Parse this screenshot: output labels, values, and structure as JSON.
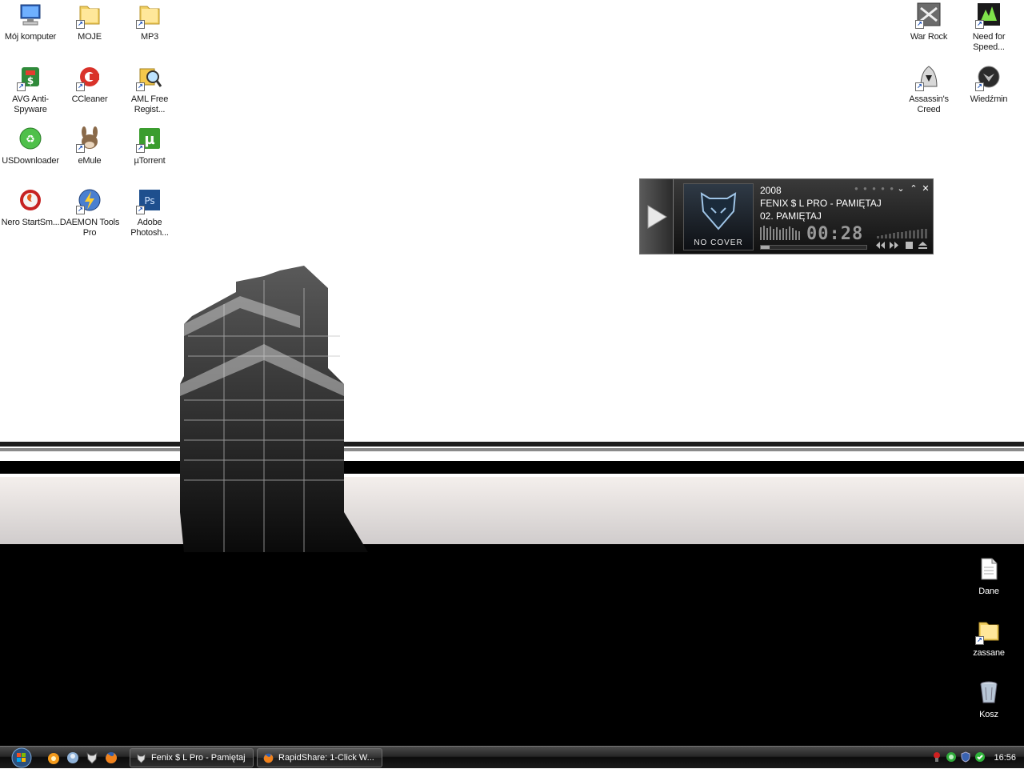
{
  "desktop": {
    "icons_left": [
      {
        "label": "Mój komputer",
        "icon": "my-computer-icon"
      },
      {
        "label": "MOJE",
        "icon": "folder-icon"
      },
      {
        "label": "MP3",
        "icon": "folder-icon"
      },
      {
        "label": "AVG Anti-Spyware",
        "icon": "avg-antispyware-icon"
      },
      {
        "label": "CCleaner",
        "icon": "ccleaner-icon"
      },
      {
        "label": "AML Free Regist...",
        "icon": "aml-registry-icon"
      },
      {
        "label": "USDownloader",
        "icon": "usdownloader-icon"
      },
      {
        "label": "eMule",
        "icon": "emule-icon"
      },
      {
        "label": "µTorrent",
        "icon": "utorrent-icon"
      },
      {
        "label": "Nero StartSm...",
        "icon": "nero-icon"
      },
      {
        "label": "DAEMON Tools Pro",
        "icon": "daemon-tools-icon"
      },
      {
        "label": "Adobe Photosh...",
        "icon": "photoshop-icon"
      }
    ],
    "icons_right": [
      {
        "label": "War Rock",
        "icon": "war-rock-icon"
      },
      {
        "label": "Need for Speed...",
        "icon": "need-for-speed-icon"
      },
      {
        "label": "Assassin's Creed",
        "icon": "assassins-creed-icon"
      },
      {
        "label": "Wiedźmin",
        "icon": "wiedzmin-icon"
      },
      {
        "label": "Dane",
        "icon": "document-icon"
      },
      {
        "label": "zassane",
        "icon": "folder-icon"
      },
      {
        "label": "Kosz",
        "icon": "recycle-bin-icon"
      }
    ]
  },
  "player": {
    "year": "2008",
    "artist_title": "FENIX $ L PRO - PAMIĘTAJ",
    "track": "02. PAMIĘTAJ",
    "time": "00:28",
    "cover_text": "NO COVER",
    "progress": 0.08,
    "controls": {
      "minimize": "⌄",
      "restore": "⌃",
      "close": "✕"
    }
  },
  "taskbar": {
    "tasks": [
      {
        "label": "Fenix $ L Pro - Pamiętaj",
        "icon": "foobar-player-icon"
      },
      {
        "label": "RapidShare: 1-Click W...",
        "icon": "firefox-icon"
      }
    ],
    "quick_launch": [
      "media-icon",
      "messenger-icon",
      "foobar-player-icon",
      "firefox-icon"
    ],
    "clock": "16:56"
  },
  "colors": {
    "taskbar": "#1b1b1b",
    "player_bg": "#1a1a1a",
    "desktop_text": "#1a1a1a"
  }
}
